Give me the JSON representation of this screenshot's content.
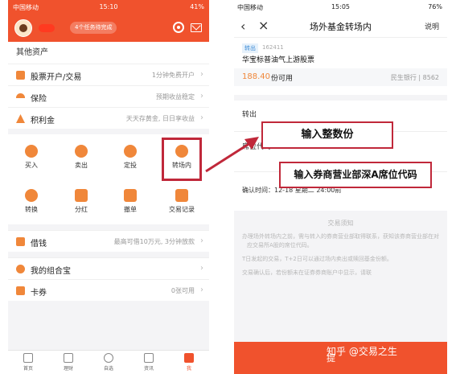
{
  "left": {
    "status": {
      "carrier": "中国移动",
      "time": "15:10",
      "battery": "41%"
    },
    "header": {
      "task_pill": "4个任务待完成"
    },
    "section_title": "其他资产",
    "rows": [
      {
        "title": "股票开户/交易",
        "hint": "1分钟免费开户"
      },
      {
        "title": "保险",
        "hint": "预期收益稳定"
      },
      {
        "title": "积利金",
        "hint": "天天存黄金, 日日享收益"
      }
    ],
    "grid": [
      {
        "label": "买入"
      },
      {
        "label": "卖出"
      },
      {
        "label": "定投"
      },
      {
        "label": "转场内"
      },
      {
        "label": "转换"
      },
      {
        "label": "分红"
      },
      {
        "label": "撤单"
      },
      {
        "label": "交易记录"
      }
    ],
    "rows2": [
      {
        "title": "借钱",
        "hint": "最高可借10万元, 3分钟放款"
      },
      {
        "title": "我的组合宝",
        "hint": ""
      },
      {
        "title": "卡券",
        "hint": "0张可用"
      }
    ],
    "tabs": [
      {
        "label": "首页"
      },
      {
        "label": "理财"
      },
      {
        "label": "自选"
      },
      {
        "label": "资讯"
      },
      {
        "label": "我"
      }
    ]
  },
  "right": {
    "status": {
      "carrier": "中国移动",
      "time": "15:05",
      "battery": "76%"
    },
    "nav": {
      "title": "场外基金转场内",
      "help": "说明"
    },
    "fund": {
      "tag": "转出",
      "code": "162411",
      "name": "华宝标普油气上游股票",
      "available_amount": "188.40",
      "available_unit": "份可用",
      "bank": "民生银行 | 8562"
    },
    "form": {
      "out_label": "转出",
      "seat_label": "席位代码",
      "confirm_time": "确认时间：12-18 星期二 24:00前"
    },
    "notice": {
      "title": "交易须知",
      "items": [
        "办理场外转场内之前，需与转入的券商营业部取得联系，获知该券商营业部在对应交易所A股的席位代码。",
        "T日发起的交易，T+2日可以通过场内卖出或赎回基金份额。",
        "交易确认后，若份额未在证券券商账户中显示，请联"
      ]
    },
    "submit_label": "提"
  },
  "annotations": {
    "callout_1": "输入整数份",
    "callout_2": "输入券商营业部深A席位代码",
    "watermark": "知乎 @交易之生"
  },
  "colors": {
    "brand_orange": "#f0522d",
    "highlight_red": "#c0283a",
    "amount_orange": "#f0873a"
  }
}
